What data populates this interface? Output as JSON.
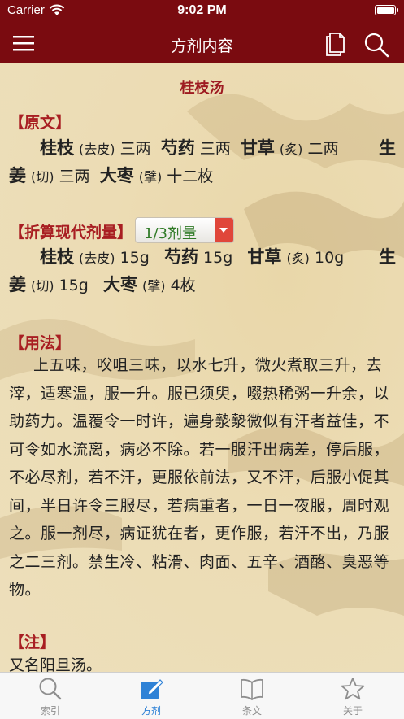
{
  "status": {
    "carrier": "Carrier",
    "time": "9:02 PM"
  },
  "nav": {
    "title": "方剂内容",
    "icons": [
      "menu-icon",
      "document-icon",
      "search-icon"
    ]
  },
  "content": {
    "formula_name": "桂枝汤",
    "original_heading": "【原文】",
    "original_herbs": {
      "h1": "桂枝",
      "p1": "(去皮)",
      "d1": "三两",
      "h2": "芍药",
      "d2": "三两",
      "h3": "甘草",
      "p3": "(炙)",
      "d3": "二两",
      "h4a": "生",
      "h4b": "姜",
      "p4": "(切)",
      "d4": "三两",
      "h5": "大枣",
      "p5": "(擘)",
      "d5": "十二枚"
    },
    "modern_heading": "【折算现代剂量】",
    "dosage_select": {
      "value": "1/3剂量"
    },
    "modern_herbs": {
      "h1": "桂枝",
      "p1": "(去皮)",
      "d1": "15g",
      "h2": "芍药",
      "d2": "15g",
      "h3": "甘草",
      "p3": "(炙)",
      "d3": "10g",
      "h4a": "生",
      "h4b": "姜",
      "p4": "(切)",
      "d4": "15g",
      "h5": "大枣",
      "p5": "(擘)",
      "d5": "4枚"
    },
    "usage_heading": "【用法】",
    "usage_text": "上五味，㕮咀三味，以水七升，微火煮取三升，去滓，适寒温，服一升。服已须臾，啜热稀粥一升余，以助药力。温覆令一时许，遍身漐漐微似有汗者益佳，不可令如水流离，病必不除。若一服汗出病差，停后服，不必尽剂，若不汗，更服依前法，又不汗，后服小促其间，半日许令三服尽，若病重者，一日一夜服，周时观之。服一剂尽，病证犹在者，更作服，若汗不出，乃服之二三剂。禁生冷、粘滑、肉面、五辛、酒酪、臭恶等物。",
    "note_heading": "【注】",
    "note_text": "又名阳旦汤。"
  },
  "tabbar": {
    "tabs": [
      {
        "label": "索引",
        "icon": "search-icon",
        "active": false
      },
      {
        "label": "方剂",
        "icon": "edit-icon",
        "active": true
      },
      {
        "label": "条文",
        "icon": "book-icon",
        "active": false
      },
      {
        "label": "关于",
        "icon": "star-icon",
        "active": false
      }
    ]
  },
  "colors": {
    "nav_bg": "#7a0b10",
    "heading": "#a81e22",
    "tab_active": "#2f82d6",
    "page_bg": "#ecdcb4"
  }
}
